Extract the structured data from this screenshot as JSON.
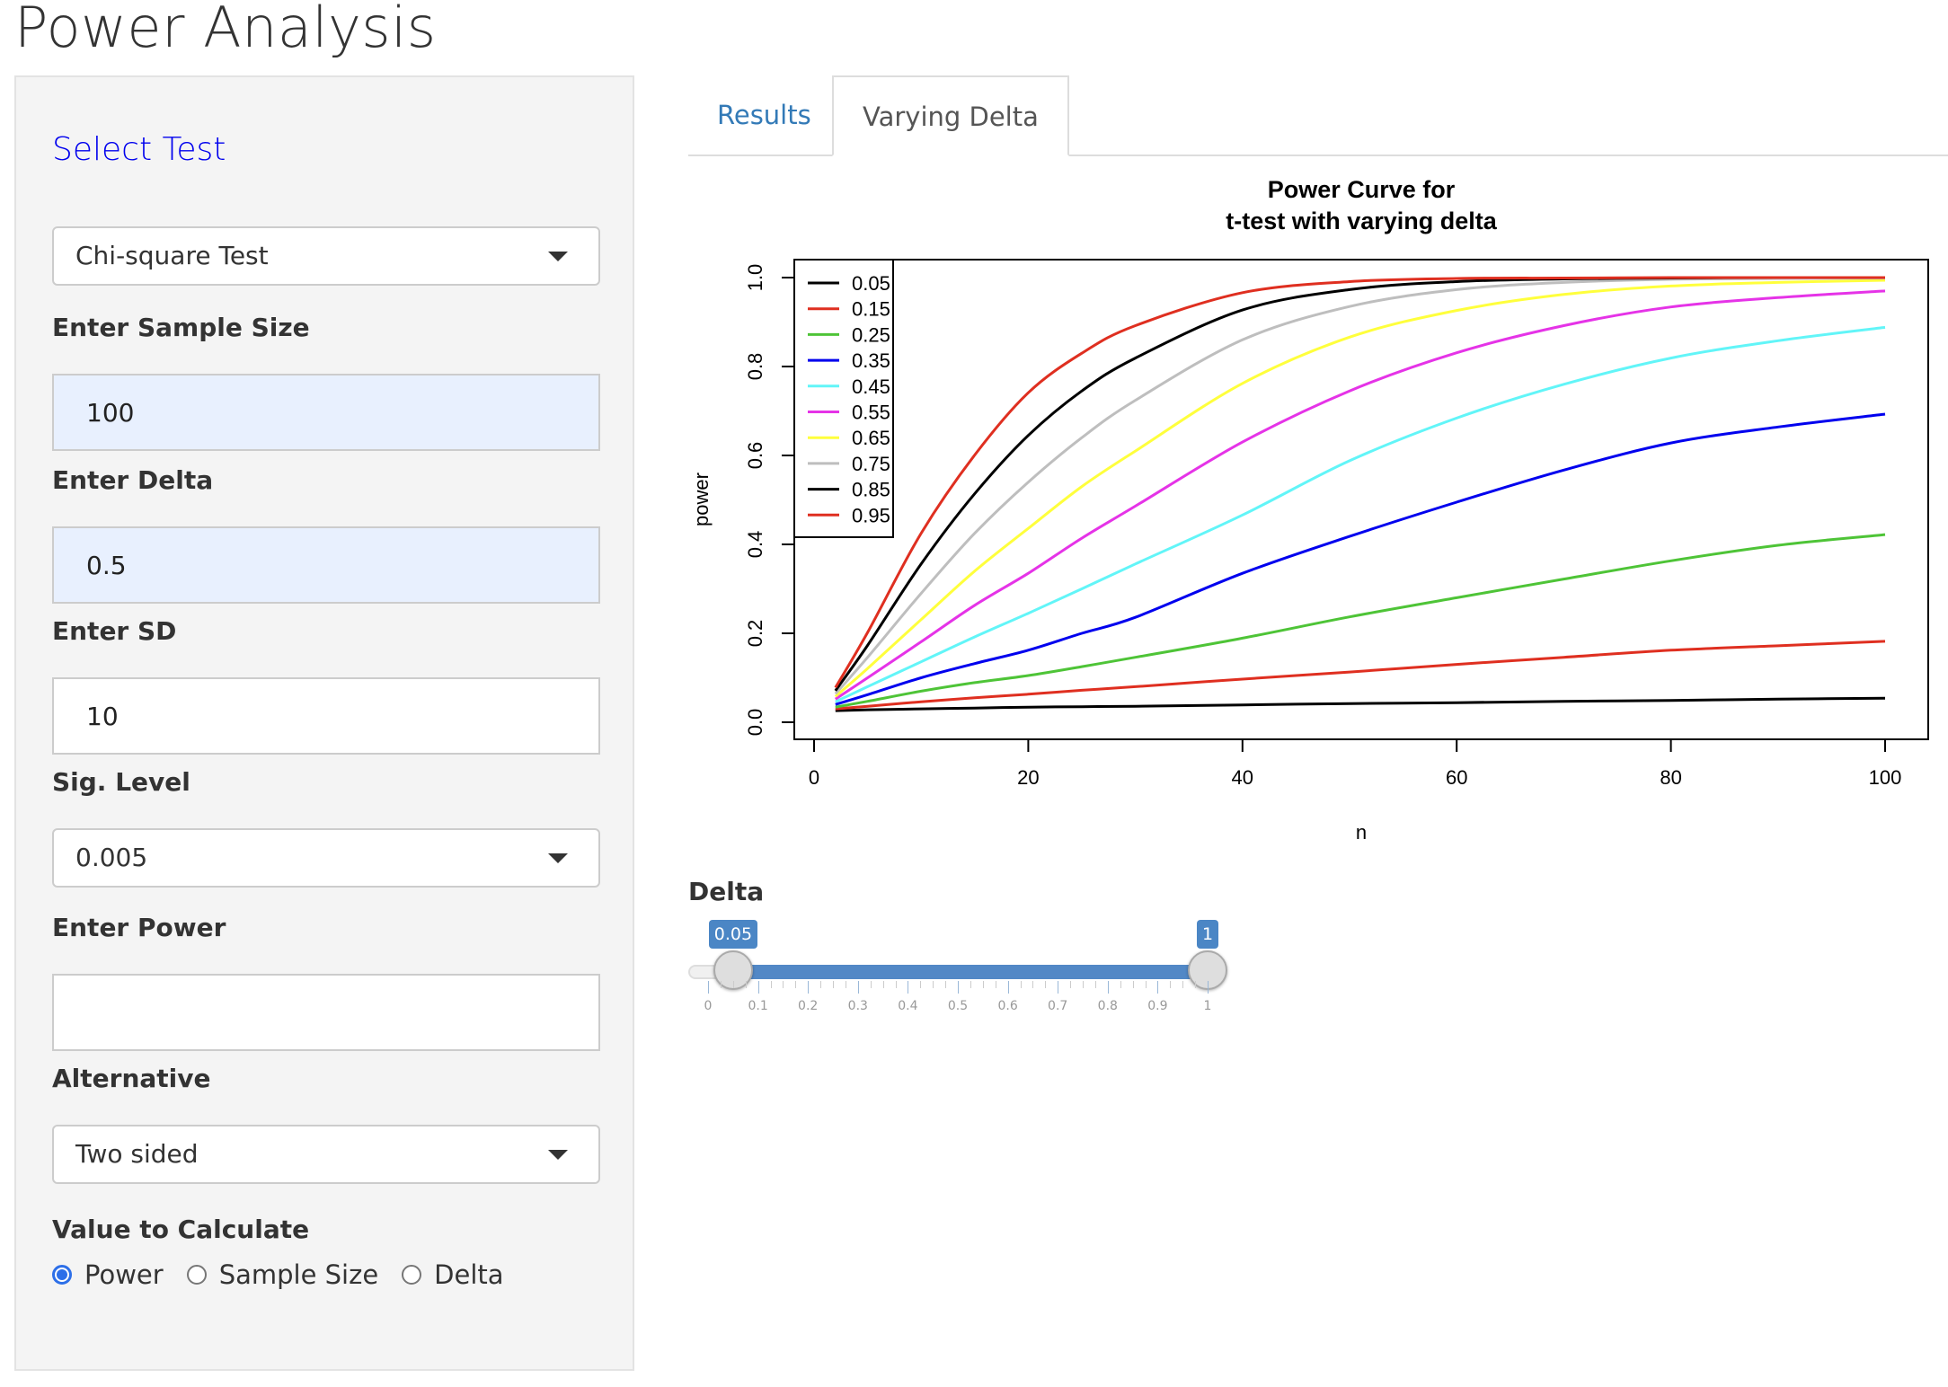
{
  "app": {
    "title": "Power Analysis"
  },
  "sidebar": {
    "select_test_heading": "Select Test",
    "test_select": {
      "value": "Chi-square Test"
    },
    "sample_size": {
      "label": "Enter Sample Size",
      "value": "100"
    },
    "delta": {
      "label": "Enter Delta",
      "value": "0.5"
    },
    "sd": {
      "label": "Enter SD",
      "value": "10"
    },
    "sig_level": {
      "label": "Sig. Level",
      "value": "0.005"
    },
    "power": {
      "label": "Enter Power",
      "value": ""
    },
    "alternative": {
      "label": "Alternative",
      "value": "Two sided"
    },
    "value_to_calculate": {
      "label": "Value to Calculate",
      "options": [
        {
          "label": "Power",
          "checked": true
        },
        {
          "label": "Sample Size",
          "checked": false
        },
        {
          "label": "Delta",
          "checked": false
        }
      ]
    }
  },
  "tabs": [
    {
      "label": "Results",
      "active": false
    },
    {
      "label": "Varying Delta",
      "active": true
    }
  ],
  "slider": {
    "label": "Delta",
    "min": 0,
    "max": 1,
    "low": 0.05,
    "high": 1,
    "low_label": "0.05",
    "high_label": "1",
    "tick_labels": [
      "0",
      "0.1",
      "0.2",
      "0.3",
      "0.4",
      "0.5",
      "0.6",
      "0.7",
      "0.8",
      "0.9",
      "1"
    ]
  },
  "chart_data": {
    "type": "line",
    "title": "Power Curve for\nt-test with varying delta",
    "title_lines": [
      "Power Curve for",
      "t-test with varying delta"
    ],
    "xlabel": "n",
    "ylabel": "power",
    "xlim": [
      0,
      100
    ],
    "ylim": [
      0,
      1
    ],
    "x_ticks": [
      0,
      20,
      40,
      60,
      80,
      100
    ],
    "x_tick_labels": [
      "0",
      "20",
      "40",
      "60",
      "80",
      "100"
    ],
    "y_ticks": [
      0,
      0.2,
      0.4,
      0.6,
      0.8,
      1.0
    ],
    "y_tick_labels": [
      "0.0",
      "0.2",
      "0.4",
      "0.6",
      "0.8",
      "1.0"
    ],
    "grid": false,
    "legend_position": "top-left",
    "x": [
      2,
      5,
      10,
      15,
      20,
      25,
      30,
      40,
      50,
      60,
      70,
      80,
      90,
      100
    ],
    "series": [
      {
        "name": "0.05",
        "color": "#000000",
        "values": [
          0.026,
          0.028,
          0.03,
          0.032,
          0.034,
          0.035,
          0.036,
          0.039,
          0.042,
          0.044,
          0.047,
          0.049,
          0.052,
          0.054
        ]
      },
      {
        "name": "0.15",
        "color": "#df2f20",
        "values": [
          0.03,
          0.036,
          0.046,
          0.055,
          0.063,
          0.072,
          0.08,
          0.097,
          0.113,
          0.13,
          0.146,
          0.162,
          0.172,
          0.182
        ]
      },
      {
        "name": "0.25",
        "color": "#4ec437",
        "values": [
          0.034,
          0.047,
          0.07,
          0.089,
          0.105,
          0.125,
          0.146,
          0.189,
          0.237,
          0.28,
          0.322,
          0.363,
          0.398,
          0.422
        ]
      },
      {
        "name": "0.35",
        "color": "#0000ee",
        "values": [
          0.04,
          0.062,
          0.1,
          0.132,
          0.162,
          0.2,
          0.236,
          0.335,
          0.418,
          0.495,
          0.567,
          0.628,
          0.664,
          0.693
        ]
      },
      {
        "name": "0.45",
        "color": "#62f5f8",
        "values": [
          0.046,
          0.08,
          0.136,
          0.192,
          0.245,
          0.3,
          0.356,
          0.466,
          0.588,
          0.684,
          0.76,
          0.819,
          0.858,
          0.888
        ]
      },
      {
        "name": "0.55",
        "color": "#e533e7",
        "values": [
          0.052,
          0.1,
          0.181,
          0.263,
          0.335,
          0.414,
          0.486,
          0.63,
          0.745,
          0.831,
          0.892,
          0.934,
          0.955,
          0.97
        ]
      },
      {
        "name": "0.65",
        "color": "#ffff3c",
        "values": [
          0.058,
          0.121,
          0.231,
          0.34,
          0.436,
          0.53,
          0.61,
          0.762,
          0.866,
          0.926,
          0.962,
          0.981,
          0.989,
          0.994
        ]
      },
      {
        "name": "0.75",
        "color": "#bebebe",
        "values": [
          0.064,
          0.146,
          0.29,
          0.425,
          0.54,
          0.64,
          0.724,
          0.86,
          0.935,
          0.973,
          0.989,
          0.996,
          0.998,
          0.999
        ]
      },
      {
        "name": "0.85",
        "color": "#000000",
        "values": [
          0.071,
          0.173,
          0.356,
          0.514,
          0.645,
          0.745,
          0.819,
          0.927,
          0.973,
          0.991,
          0.997,
          0.999,
          1.0,
          1.0
        ]
      },
      {
        "name": "0.95",
        "color": "#df2f20",
        "values": [
          0.078,
          0.202,
          0.425,
          0.601,
          0.741,
          0.83,
          0.892,
          0.966,
          0.991,
          0.998,
          0.999,
          1.0,
          1.0,
          1.0
        ]
      }
    ]
  }
}
